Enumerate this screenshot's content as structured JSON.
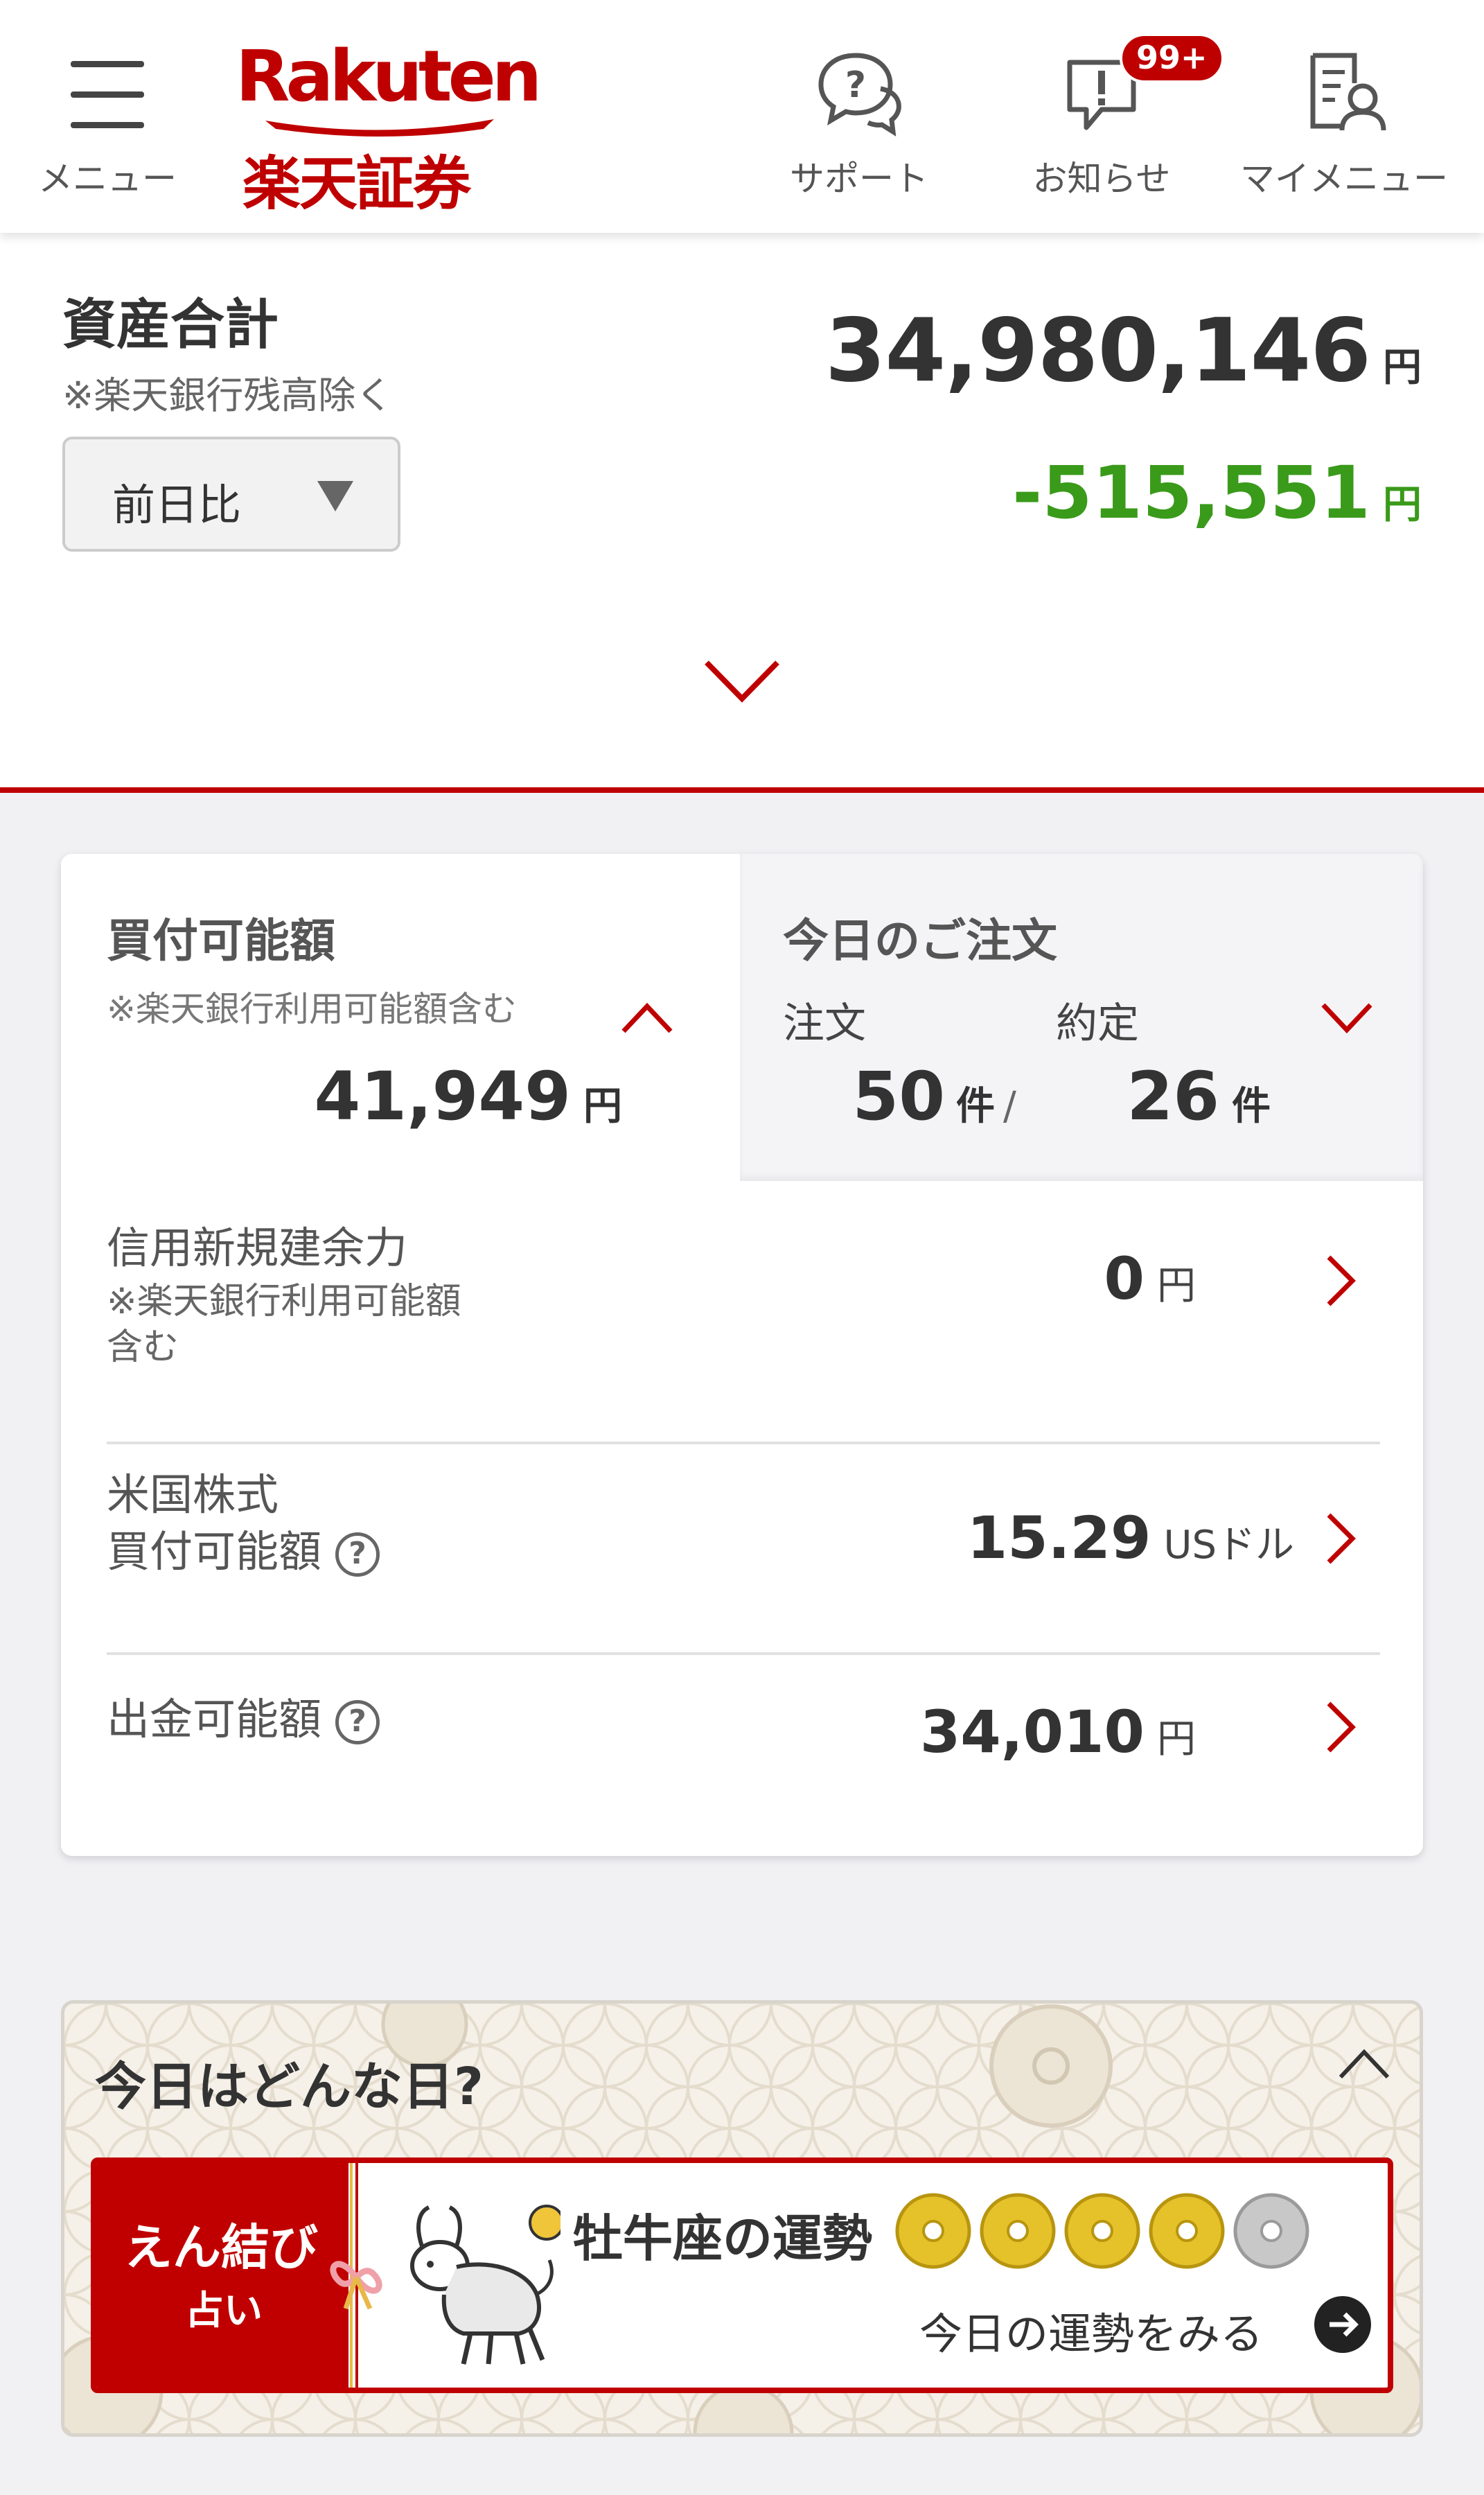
{
  "header": {
    "menu_label": "メニュー",
    "logo_top": "Rakuten",
    "logo_bottom": "楽天証券",
    "support_label": "サポート",
    "notice_label": "お知らせ",
    "notice_badge": "99+",
    "mymenu_label": "マイメニュー"
  },
  "summary": {
    "title": "資産合計",
    "note": "※楽天銀行残高除く",
    "compare_selected": "前日比",
    "total_value": "34,980,146",
    "total_unit": "円",
    "diff_value": "-515,551",
    "diff_unit": "円"
  },
  "buying_power": {
    "title": "買付可能額",
    "note": "※楽天銀行利用可能額含む",
    "value": "41,949",
    "unit": "円"
  },
  "orders": {
    "title": "今日のご注文",
    "order_label": "注文",
    "executed_label": "約定",
    "order_count": "50",
    "executed_count": "26",
    "count_unit": "件",
    "separator": "/"
  },
  "rows": [
    {
      "label": "信用新規建余力",
      "note_line1": "※楽天銀行利用可能額",
      "note_line2": "含む",
      "value": "0",
      "unit": "円"
    },
    {
      "label_line1": "米国株式",
      "label_line2": "買付可能額",
      "value": "15.29",
      "unit": "USドル"
    },
    {
      "label": "出金可能額",
      "value": "34,010",
      "unit": "円"
    }
  ],
  "fortune": {
    "title": "今日はどんな日?",
    "banner_tag1": "えん結び",
    "banner_tag2": "占い",
    "banner_title": "牡牛座の運勢",
    "banner_cta": "今日の運勢をみる",
    "rating": 4,
    "rating_max": 5
  },
  "colors": {
    "brand_red": "#bf0000",
    "negative_green": "#3a9a1a",
    "coin_gold": "#e6c22a",
    "coin_silver": "#c8c8c8"
  }
}
